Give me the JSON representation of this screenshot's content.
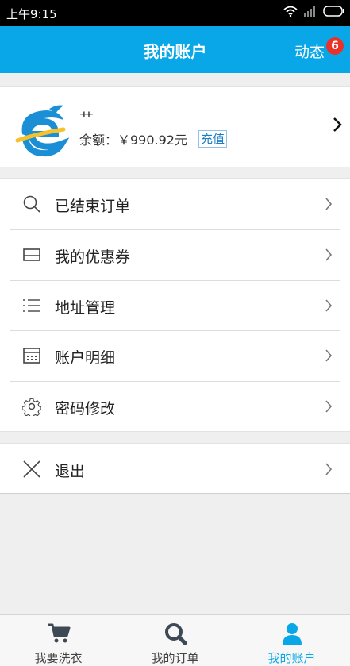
{
  "status_bar": {
    "time": "上午9:15"
  },
  "header": {
    "title": "我的账户",
    "activity_label": "动态",
    "activity_badge": "6"
  },
  "profile": {
    "name": "艹",
    "balance_text": "余额：￥990.92元",
    "recharge_label": "充值"
  },
  "menu": [
    {
      "label": "已结束订单",
      "icon": "search-icon"
    },
    {
      "label": "我的优惠券",
      "icon": "coupon-icon"
    },
    {
      "label": "地址管理",
      "icon": "list-icon"
    },
    {
      "label": "账户明细",
      "icon": "calculator-icon"
    },
    {
      "label": "密码修改",
      "icon": "gear-icon"
    }
  ],
  "logout": {
    "label": "退出",
    "icon": "close-icon"
  },
  "tabs": [
    {
      "label": "我要洗衣",
      "icon": "cart-icon"
    },
    {
      "label": "我的订单",
      "icon": "search-icon"
    },
    {
      "label": "我的账户",
      "icon": "user-icon",
      "active": true
    }
  ],
  "colors": {
    "accent": "#0aa7e8",
    "badge": "#e8322a"
  }
}
